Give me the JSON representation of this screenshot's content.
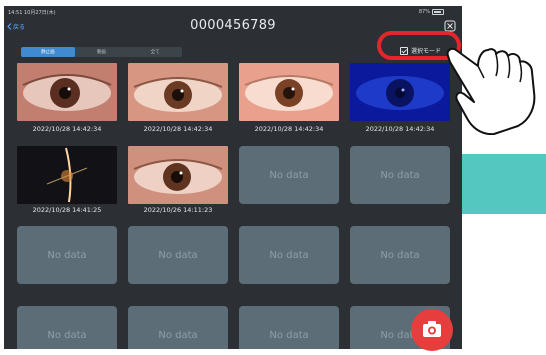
{
  "status": {
    "time": "14:51 10月27日(木)",
    "battery": "87%"
  },
  "nav": {
    "back_label": "戻る"
  },
  "header": {
    "title": "0000456789"
  },
  "segments": [
    {
      "label": "静止画"
    },
    {
      "label": "動画"
    },
    {
      "label": "全て"
    }
  ],
  "select_mode": {
    "label": "選択モード"
  },
  "grid": {
    "row1": [
      {
        "timestamp": "2022/10/28 14:42:34"
      },
      {
        "timestamp": "2022/10/28 14:42:34"
      },
      {
        "timestamp": "2022/10/28 14:42:34"
      },
      {
        "timestamp": "2022/10/28 14:42:34"
      }
    ],
    "row2": [
      {
        "timestamp": "2022/10/28 14:41:25"
      },
      {
        "timestamp": "2022/10/26 14:11:23"
      }
    ],
    "no_data_label": "No data"
  },
  "colors": {
    "background": "#2c3035",
    "accent": "#3f8ad0",
    "empty_tile": "#5d6d77",
    "camera_button": "#e63d3d",
    "highlight": "#e4262a",
    "teal_band": "#55c7c1"
  },
  "icons": [
    "back-chevron-icon",
    "battery-icon",
    "checkbox-icon",
    "camera-icon",
    "pointing-hand-icon"
  ]
}
